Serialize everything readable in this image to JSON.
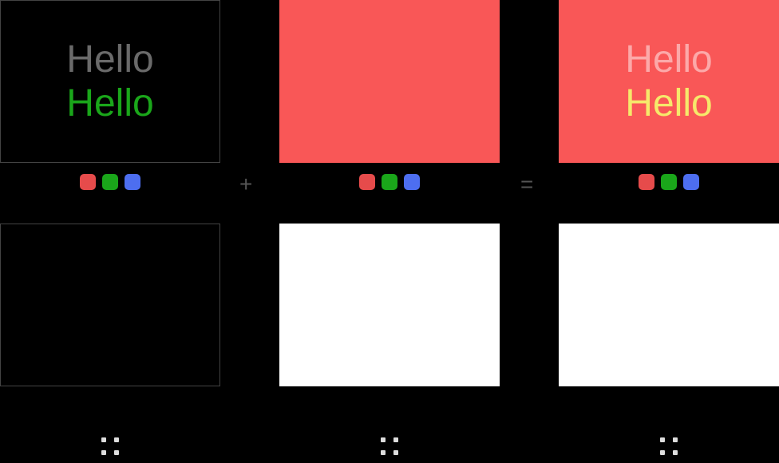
{
  "text": {
    "line1": "Hello",
    "line2": "Hello"
  },
  "colors": {
    "panel_black": "#000000",
    "panel_red": "#f95757",
    "panel_white": "#ffffff",
    "grey_text": "#6a6a6a",
    "green_text": "#1aa61a",
    "pink_text": "#fca9a9",
    "yellow_text": "#f6e96b",
    "swatch_red": "#e64b4b",
    "swatch_green": "#1aa61a",
    "swatch_blue": "#4d6ef0"
  },
  "ops": {
    "plus": "+",
    "equals": "="
  }
}
